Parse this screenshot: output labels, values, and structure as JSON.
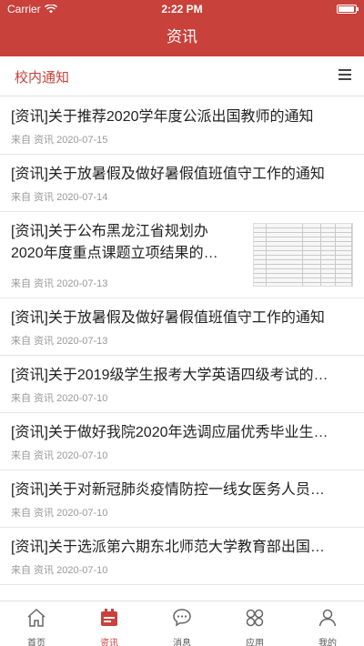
{
  "status_bar": {
    "carrier": "Carrier",
    "time": "2:22 PM"
  },
  "nav": {
    "title": "资讯"
  },
  "section": {
    "title": "校内通知"
  },
  "news": [
    {
      "title": "[资讯]关于推荐2020学年度公派出国教师的通知",
      "source": "来自 资讯",
      "date": "2020-07-15"
    },
    {
      "title": "[资讯]关于放暑假及做好暑假值班值守工作的通知",
      "source": "来自 资讯",
      "date": "2020-07-14"
    },
    {
      "title": "[资讯]关于公布黑龙江省规划办2020年度重点课题立项结果的…",
      "source": "来自 资讯",
      "date": "2020-07-13"
    },
    {
      "title": "[资讯]关于放暑假及做好暑假值班值守工作的通知",
      "source": "来自 资讯",
      "date": "2020-07-13"
    },
    {
      "title": "[资讯]关于2019级学生报考大学英语四级考试的…",
      "source": "来自 资讯",
      "date": "2020-07-10"
    },
    {
      "title": "[资讯]关于做好我院2020年选调应届优秀毕业生…",
      "source": "来自 资讯",
      "date": "2020-07-10"
    },
    {
      "title": "[资讯]关于对新冠肺炎疫情防控一线女医务人员…",
      "source": "来自 资讯",
      "date": "2020-07-10"
    },
    {
      "title": "[资讯]关于选派第六期东北师范大学教育部出国…",
      "source": "来自 资讯",
      "date": "2020-07-10"
    }
  ],
  "tabs": [
    {
      "label": "首页",
      "icon": "home-icon"
    },
    {
      "label": "资讯",
      "icon": "news-icon"
    },
    {
      "label": "消息",
      "icon": "message-icon"
    },
    {
      "label": "应用",
      "icon": "apps-icon"
    },
    {
      "label": "我的",
      "icon": "profile-icon"
    }
  ],
  "colors": {
    "accent": "#c8413a",
    "text": "#222222",
    "meta": "#999999"
  }
}
